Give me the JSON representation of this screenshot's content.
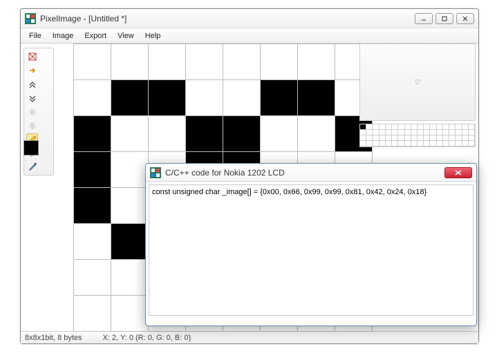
{
  "app": {
    "title": "PixelImage - [Untitled *]",
    "menu": {
      "file": "File",
      "image": "Image",
      "export": "Export",
      "view": "View",
      "help": "Help"
    }
  },
  "status": {
    "dimensions": "8x8x1bit, 8 bytes",
    "cursor": "X: 2, Y: 0 (R: 0, G: 0, B: 0)"
  },
  "colors": {
    "primary": "#000000"
  },
  "pixels": [
    [
      0,
      0,
      0,
      0,
      0,
      0,
      0,
      0
    ],
    [
      0,
      1,
      1,
      0,
      0,
      1,
      1,
      0
    ],
    [
      1,
      0,
      0,
      1,
      1,
      0,
      0,
      1
    ],
    [
      1,
      0,
      0,
      1,
      1,
      0,
      0,
      0
    ],
    [
      1,
      0,
      0,
      0,
      0,
      0,
      0,
      0
    ],
    [
      0,
      1,
      0,
      0,
      0,
      0,
      0,
      0
    ],
    [
      0,
      0,
      1,
      0,
      0,
      0,
      0,
      0
    ],
    [
      0,
      0,
      0,
      0,
      0,
      0,
      0,
      0
    ]
  ],
  "preview": {
    "symbol": "♡"
  },
  "dialog": {
    "title": "C/C++ code for Nokia 1202 LCD",
    "code": "const unsigned char _image[] = {0x00, 0x66, 0x99, 0x99, 0x81, 0x42, 0x24, 0x18}"
  }
}
